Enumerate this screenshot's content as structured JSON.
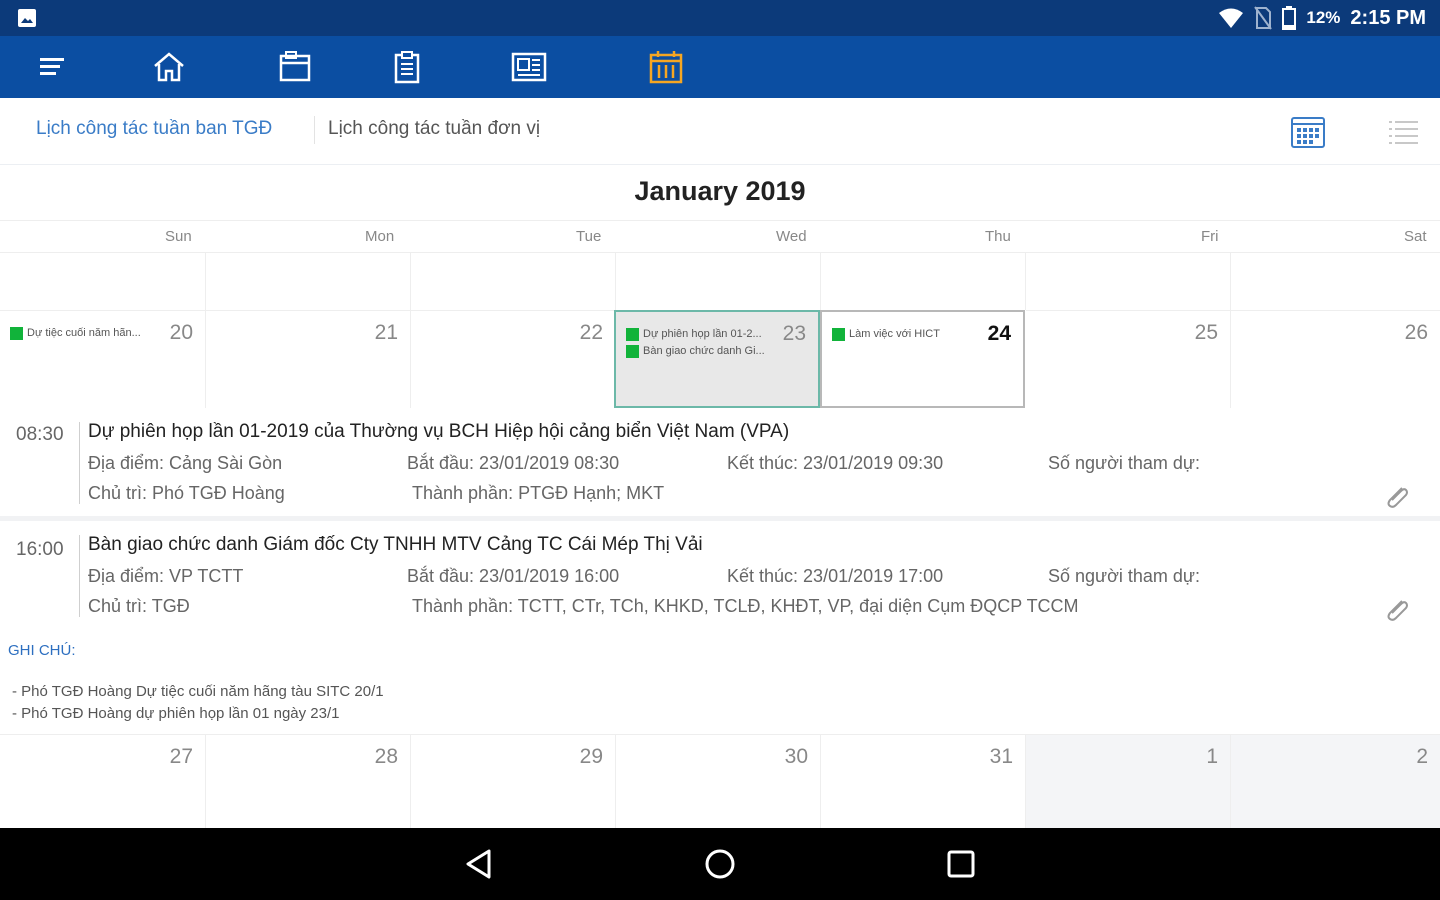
{
  "status_bar": {
    "battery": "12%",
    "time": "2:15 PM"
  },
  "toolbar": {
    "items": [
      "menu-icon",
      "home-icon",
      "folder-icon",
      "clipboard-icon",
      "newspaper-icon",
      "calendar-icon"
    ],
    "active_color": "#f5a623"
  },
  "tabs": {
    "active": "Lịch công tác tuần ban TGĐ",
    "inactive": "Lịch công tác tuần đơn vị"
  },
  "calendar": {
    "month_title": "January 2019",
    "weekdays": [
      "Sun",
      "Mon",
      "Tue",
      "Wed",
      "Thu",
      "Fri",
      "Sat"
    ],
    "week1": [
      "20",
      "21",
      "22",
      "23",
      "24",
      "25",
      "26"
    ],
    "week2": [
      "27",
      "28",
      "29",
      "30",
      "31",
      "1",
      "2"
    ],
    "cell_events": {
      "sun_20": "Dự tiệc cuối năm hãn...",
      "wed_23_a": "Dự phiên họp lần 01-2...",
      "wed_23_b": "Bàn giao chức danh Gi...",
      "thu_24": "Làm việc với HICT"
    }
  },
  "events": [
    {
      "time": "08:30",
      "title": "Dự phiên họp lần 01-2019 của Thường vụ BCH Hiệp hội cảng biển Việt Nam (VPA)",
      "location": "Địa điểm: Cảng Sài Gòn",
      "start": "Bắt đầu: 23/01/2019 08:30",
      "end": "Kết thúc: 23/01/2019 09:30",
      "attendees": "Số người tham dự:",
      "chair": "Chủ trì: Phó TGĐ Hoàng",
      "members": "Thành phần: PTGĐ Hạnh; MKT"
    },
    {
      "time": "16:00",
      "title": "Bàn giao chức danh Giám đốc Cty TNHH MTV Cảng TC Cái Mép Thị Vải",
      "location": "Địa điểm: VP TCTT",
      "start": "Bắt đầu: 23/01/2019 16:00",
      "end": "Kết thúc: 23/01/2019 17:00",
      "attendees": "Số người tham dự:",
      "chair": "Chủ trì: TGĐ",
      "members": "Thành phần: TCTT, CTr, TCh, KHKD, TCLĐ, KHĐT, VP, đại diện Cụm ĐQCP TCCM"
    }
  ],
  "notes": {
    "title": "GHI CHÚ:",
    "lines": [
      "- Phó TGĐ Hoàng Dự tiệc cuối năm hãng tàu SITC 20/1",
      "- Phó TGĐ Hoàng dự phiên họp lần 01 ngày 23/1"
    ]
  },
  "colors": {
    "status_bar": "#0c3a7a",
    "toolbar": "#0b4ea2",
    "accent_blue": "#3a7cc7",
    "event_green": "#11b33a",
    "selected_border": "#6cb8a8"
  }
}
